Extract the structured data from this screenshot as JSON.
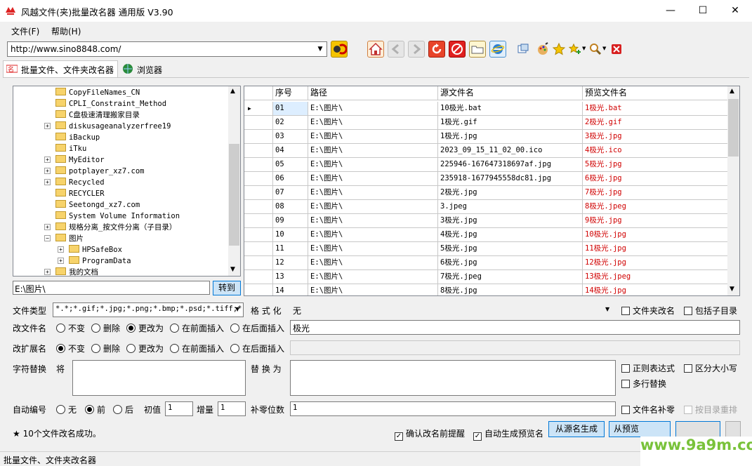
{
  "window": {
    "title": "风越文件(夹)批量改名器 通用版 V3.90"
  },
  "menu": {
    "items": [
      "文件(F)",
      "帮助(H)"
    ]
  },
  "toolbar": {
    "url": "http://www.sino8848.com/"
  },
  "tabs": [
    {
      "label": "批量文件、文件夹改名器"
    },
    {
      "label": "浏览器"
    }
  ],
  "tree": {
    "items": [
      {
        "label": "CopyFileNames_CN",
        "expandable": false,
        "depth": 0
      },
      {
        "label": "CPLI_Constraint_Method",
        "expandable": false,
        "depth": 0
      },
      {
        "label": "C盘极速清理搬家目录",
        "expandable": false,
        "depth": 0
      },
      {
        "label": "diskusageanalyzerfree19",
        "expandable": true,
        "depth": 0
      },
      {
        "label": "iBackup",
        "expandable": false,
        "depth": 0
      },
      {
        "label": "iTku",
        "expandable": false,
        "depth": 0
      },
      {
        "label": "MyEditor",
        "expandable": true,
        "depth": 0
      },
      {
        "label": "potplayer_xz7.com",
        "expandable": true,
        "depth": 0
      },
      {
        "label": "Recycled",
        "expandable": true,
        "depth": 0
      },
      {
        "label": "RECYCLER",
        "expandable": false,
        "depth": 0
      },
      {
        "label": "Seetongd_xz7.com",
        "expandable": false,
        "depth": 0
      },
      {
        "label": "System Volume Information",
        "expandable": false,
        "depth": 0
      },
      {
        "label": "规格分离_按文件分离（子目录）",
        "expandable": true,
        "depth": 0
      },
      {
        "label": "图片",
        "expandable": true,
        "expanded": true,
        "depth": 0
      },
      {
        "label": "HPSafeBox",
        "expandable": true,
        "depth": 1
      },
      {
        "label": "ProgramData",
        "expandable": true,
        "depth": 1
      },
      {
        "label": "我的文档",
        "expandable": true,
        "depth": 0
      }
    ]
  },
  "path_input": {
    "value": "E:\\图片\\"
  },
  "goto_button": {
    "label": "转到"
  },
  "grid": {
    "headers": [
      "序号",
      "路径",
      "源文件名",
      "预览文件名"
    ],
    "rows": [
      [
        "01",
        "E:\\图片\\",
        "10极光.bat",
        "1极光.bat"
      ],
      [
        "02",
        "E:\\图片\\",
        "1极光.gif",
        "2极光.gif"
      ],
      [
        "03",
        "E:\\图片\\",
        "1极光.jpg",
        "3极光.jpg"
      ],
      [
        "04",
        "E:\\图片\\",
        "2023_09_15_11_02_00.ico",
        "4极光.ico"
      ],
      [
        "05",
        "E:\\图片\\",
        "225946-167647318697af.jpg",
        "5极光.jpg"
      ],
      [
        "06",
        "E:\\图片\\",
        "235918-1677945558dc81.jpg",
        "6极光.jpg"
      ],
      [
        "07",
        "E:\\图片\\",
        "2极光.jpg",
        "7极光.jpg"
      ],
      [
        "08",
        "E:\\图片\\",
        "3.jpeg",
        "8极光.jpeg"
      ],
      [
        "09",
        "E:\\图片\\",
        "3极光.jpg",
        "9极光.jpg"
      ],
      [
        "10",
        "E:\\图片\\",
        "4极光.jpg",
        "10极光.jpg"
      ],
      [
        "11",
        "E:\\图片\\",
        "5极光.jpg",
        "11极光.jpg"
      ],
      [
        "12",
        "E:\\图片\\",
        "6极光.jpg",
        "12极光.jpg"
      ],
      [
        "13",
        "E:\\图片\\",
        "7极光.jpeg",
        "13极光.jpeg"
      ],
      [
        "14",
        "E:\\图片\\",
        "8极光.jpg",
        "14极光.jpg"
      ]
    ]
  },
  "form": {
    "file_type_label": "文件类型",
    "file_type_value": "*.*;*.gif;*.jpg;*.png;*.bmp;*.psd;*.tiff;*",
    "format_label": "格 式 化",
    "format_value": "无",
    "folder_rename_label": "文件夹改名",
    "include_subdir_label": "包括子目录",
    "rename_label": "改文件名",
    "rename_options": [
      "不变",
      "删除",
      "更改为",
      "在前面插入",
      "在后面插入"
    ],
    "rename_value": "极光",
    "ext_label": "改扩展名",
    "ext_options": [
      "不变",
      "删除",
      "更改为",
      "在前面插入",
      "在后面插入"
    ],
    "replace_label": "字符替换",
    "replace_from_label": "将",
    "replace_to_label": "替 换 为",
    "regex_label": "正则表达式",
    "case_label": "区分大小写",
    "multiline_label": "多行替换",
    "autonum_label": "自动编号",
    "autonum_options": [
      "无",
      "前",
      "后"
    ],
    "init_label": "初值",
    "init_value": "1",
    "step_label": "增量",
    "step_value": "1",
    "pad_label": "补零位数",
    "pad_value": "1",
    "name_pad_label": "文件名补零",
    "dir_sort_label": "按目录重排"
  },
  "bottom": {
    "message": "10个文件改名成功。",
    "confirm_label": "确认改名前提醒",
    "auto_preview_label": "自动生成预览名",
    "gen_from_source": "从源名生成",
    "gen_from_preview": "从预览"
  },
  "status": {
    "text": "批量文件、文件夹改名器"
  },
  "watermark": {
    "text": "www.9a9m.com"
  },
  "colors": {
    "preview_text": "#d00000",
    "accent": "#0078d7",
    "watermark": "#79c23a"
  }
}
